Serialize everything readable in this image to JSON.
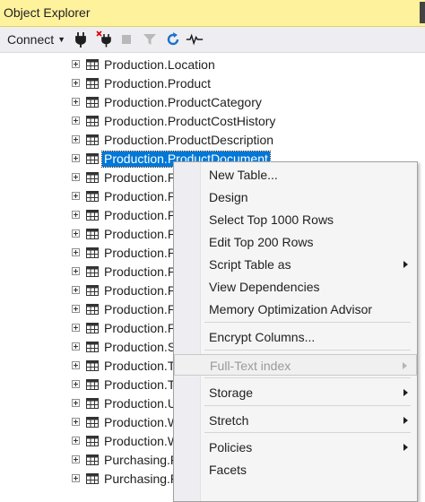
{
  "window": {
    "title": "Object Explorer"
  },
  "toolbar": {
    "connect_label": "Connect",
    "icons": [
      "connect-plug-icon",
      "disconnect-plug-icon",
      "stop-icon",
      "filter-icon",
      "refresh-icon",
      "activity-monitor-icon"
    ]
  },
  "tree": {
    "rows": [
      {
        "label": "Production.Location"
      },
      {
        "label": "Production.Product"
      },
      {
        "label": "Production.ProductCategory"
      },
      {
        "label": "Production.ProductCostHistory"
      },
      {
        "label": "Production.ProductDescription"
      },
      {
        "label": "Production.ProductDocument",
        "selected": true
      },
      {
        "label": "Production.P"
      },
      {
        "label": "Production.P"
      },
      {
        "label": "Production.P"
      },
      {
        "label": "Production.P"
      },
      {
        "label": "Production.P"
      },
      {
        "label": "Production.P"
      },
      {
        "label": "Production.P"
      },
      {
        "label": "Production.P"
      },
      {
        "label": "Production.P"
      },
      {
        "label": "Production.S"
      },
      {
        "label": "Production.T"
      },
      {
        "label": "Production.T"
      },
      {
        "label": "Production.U"
      },
      {
        "label": "Production.W"
      },
      {
        "label": "Production.W"
      },
      {
        "label": "Purchasing.P"
      },
      {
        "label": "Purchasing.P"
      }
    ]
  },
  "context_menu": {
    "items": [
      {
        "label": "New Table..."
      },
      {
        "label": "Design"
      },
      {
        "label": "Select Top 1000 Rows"
      },
      {
        "label": "Edit Top 200 Rows"
      },
      {
        "label": "Script Table as",
        "submenu": true
      },
      {
        "label": "View Dependencies"
      },
      {
        "label": "Memory Optimization Advisor"
      },
      {
        "label": "Encrypt Columns..."
      },
      {
        "label": "Full-Text index",
        "submenu": true,
        "disabled": true
      },
      {
        "label": "Storage",
        "submenu": true
      },
      {
        "label": "Stretch",
        "submenu": true
      },
      {
        "label": "Policies",
        "submenu": true
      },
      {
        "label": "Facets"
      }
    ]
  },
  "colors": {
    "title_bg": "#fff29d",
    "selection": "#0078d7",
    "refresh_icon": "#1e73c8"
  }
}
